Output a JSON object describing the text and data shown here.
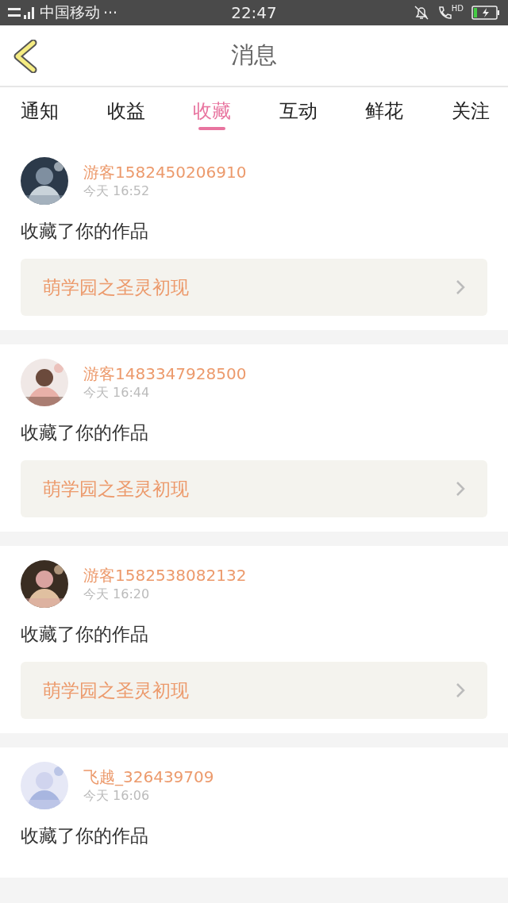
{
  "status_bar": {
    "carrier": "中国移动",
    "more": "···",
    "time": "22:47",
    "call_label": "HD"
  },
  "header": {
    "title": "消息"
  },
  "tabs": [
    {
      "label": "通知",
      "selected": false
    },
    {
      "label": "收益",
      "selected": false
    },
    {
      "label": "收藏",
      "selected": true
    },
    {
      "label": "互动",
      "selected": false
    },
    {
      "label": "鲜花",
      "selected": false
    },
    {
      "label": "关注",
      "selected": false
    }
  ],
  "messages": [
    {
      "user": "游客1582450206910",
      "time": "今天 16:52",
      "text": "收藏了你的作品",
      "work": "萌学园之圣灵初现"
    },
    {
      "user": "游客1483347928500",
      "time": "今天 16:44",
      "text": "收藏了你的作品",
      "work": "萌学园之圣灵初现"
    },
    {
      "user": "游客1582538082132",
      "time": "今天 16:20",
      "text": "收藏了你的作品",
      "work": "萌学园之圣灵初现"
    },
    {
      "user": "飞越_326439709",
      "time": "今天 16:06",
      "text": "收藏了你的作品"
    }
  ]
}
